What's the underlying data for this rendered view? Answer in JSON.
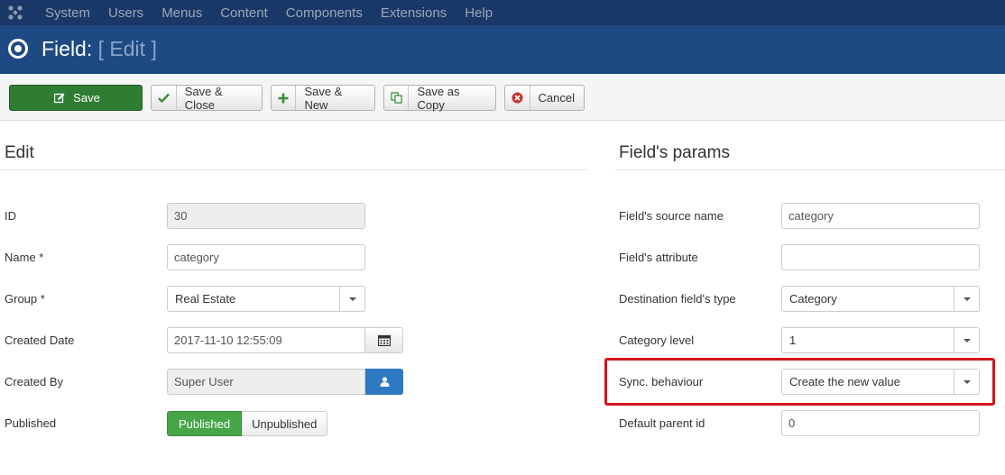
{
  "topnav": {
    "logo_icon": "joomla-icon",
    "items": [
      "System",
      "Users",
      "Menus",
      "Content",
      "Components",
      "Extensions",
      "Help"
    ]
  },
  "title": {
    "main": "Field:",
    "sub": "[ Edit ]",
    "icon": "target-icon"
  },
  "toolbar": {
    "save": "Save",
    "save_close": "Save & Close",
    "save_new": "Save & New",
    "save_copy": "Save as Copy",
    "cancel": "Cancel"
  },
  "edit": {
    "heading": "Edit",
    "id_label": "ID",
    "id_value": "30",
    "name_label": "Name *",
    "name_value": "category",
    "group_label": "Group *",
    "group_value": "Real Estate",
    "created_date_label": "Created Date",
    "created_date_value": "2017-11-10 12:55:09",
    "created_by_label": "Created By",
    "created_by_value": "Super User",
    "published_label": "Published",
    "published_on": "Published",
    "published_off": "Unpublished"
  },
  "params": {
    "heading": "Field's params",
    "source_name_label": "Field's source name",
    "source_name_value": "category",
    "attribute_label": "Field's attribute",
    "attribute_value": "",
    "dest_type_label": "Destination field's type",
    "dest_type_value": "Category",
    "cat_level_label": "Category level",
    "cat_level_value": "1",
    "sync_label": "Sync. behaviour",
    "sync_value": "Create the new value",
    "parent_id_label": "Default parent id",
    "parent_id_value": "0"
  },
  "colors": {
    "nav_bg": "#1a3867",
    "title_bg": "#1d4a83",
    "save_green": "#2f7d32",
    "published_green": "#46a546",
    "user_blue": "#2d79c2",
    "highlight_red": "#d4141b"
  }
}
